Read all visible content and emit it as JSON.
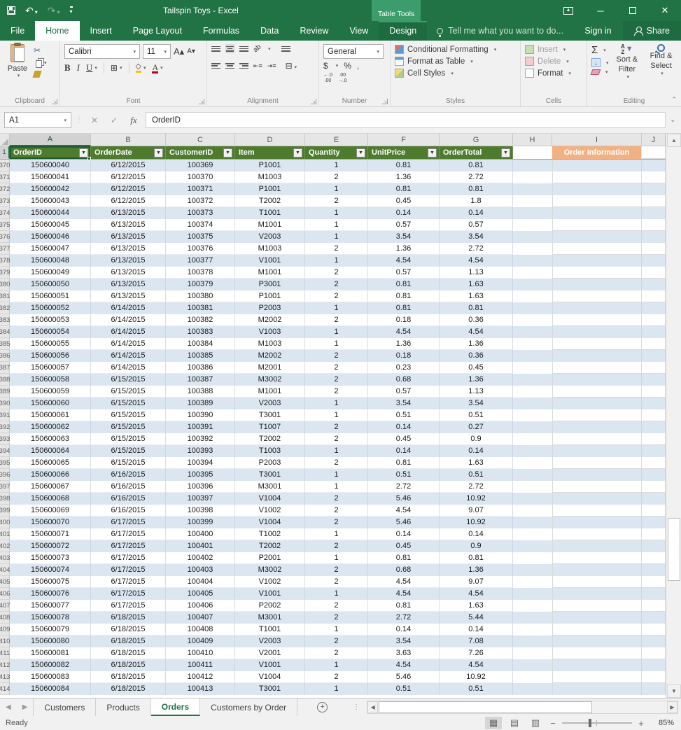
{
  "colors": {
    "brand_green": "#217346",
    "table_header_green": "#4f7b2f",
    "band_blue": "#dce6f1",
    "info_orange": "#f2b183"
  },
  "window": {
    "title": "Tailspin Toys - Excel",
    "context_tab_group": "Table Tools"
  },
  "menu": {
    "tabs": [
      {
        "label": "File",
        "style": "file"
      },
      {
        "label": "Home",
        "style": "active"
      },
      {
        "label": "Insert",
        "style": ""
      },
      {
        "label": "Page Layout",
        "style": ""
      },
      {
        "label": "Formulas",
        "style": ""
      },
      {
        "label": "Data",
        "style": ""
      },
      {
        "label": "Review",
        "style": ""
      },
      {
        "label": "View",
        "style": ""
      },
      {
        "label": "Design",
        "style": "contextual"
      }
    ],
    "tell_me": "Tell me what you want to do...",
    "sign_in": "Sign in",
    "share": "Share"
  },
  "ribbon": {
    "clipboard": {
      "label": "Clipboard",
      "paste": "Paste"
    },
    "font": {
      "label": "Font",
      "name": "Calibri",
      "size": "11",
      "bold": "B",
      "italic": "I",
      "underline": "U"
    },
    "alignment": {
      "label": "Alignment"
    },
    "number": {
      "label": "Number",
      "format": "General",
      "currency": "$",
      "percent": "%",
      "comma": ","
    },
    "styles": {
      "label": "Styles",
      "conditional": "Conditional Formatting",
      "format_table": "Format as Table",
      "cell_styles": "Cell Styles"
    },
    "cells": {
      "label": "Cells",
      "insert": "Insert",
      "delete": "Delete",
      "format": "Format"
    },
    "editing": {
      "label": "Editing",
      "sort_filter": "Sort & Filter",
      "find_select": "Find & Select"
    }
  },
  "formula_bar": {
    "name_box": "A1",
    "fx": "fx",
    "value": "OrderID"
  },
  "sheet": {
    "col_letters": [
      "A",
      "B",
      "C",
      "D",
      "E",
      "F",
      "G",
      "H",
      "I",
      "J"
    ],
    "header_row_num": "1",
    "table_headers": [
      "OrderID",
      "OrderDate",
      "CustomerID",
      "Item",
      "Quantity",
      "UnitPrice",
      "OrderTotal"
    ],
    "info_header": "Order Information",
    "rows": [
      {
        "n": "370",
        "v": [
          "150600040",
          "6/12/2015",
          "100369",
          "P1001",
          "1",
          "0.81",
          "0.81"
        ]
      },
      {
        "n": "371",
        "v": [
          "150600041",
          "6/12/2015",
          "100370",
          "M1003",
          "2",
          "1.36",
          "2.72"
        ]
      },
      {
        "n": "372",
        "v": [
          "150600042",
          "6/12/2015",
          "100371",
          "P1001",
          "1",
          "0.81",
          "0.81"
        ]
      },
      {
        "n": "373",
        "v": [
          "150600043",
          "6/12/2015",
          "100372",
          "T2002",
          "2",
          "0.45",
          "1.8"
        ]
      },
      {
        "n": "374",
        "v": [
          "150600044",
          "6/13/2015",
          "100373",
          "T1001",
          "1",
          "0.14",
          "0.14"
        ]
      },
      {
        "n": "375",
        "v": [
          "150600045",
          "6/13/2015",
          "100374",
          "M1001",
          "1",
          "0.57",
          "0.57"
        ]
      },
      {
        "n": "376",
        "v": [
          "150600046",
          "6/13/2015",
          "100375",
          "V2003",
          "1",
          "3.54",
          "3.54"
        ]
      },
      {
        "n": "377",
        "v": [
          "150600047",
          "6/13/2015",
          "100376",
          "M1003",
          "2",
          "1.36",
          "2.72"
        ]
      },
      {
        "n": "378",
        "v": [
          "150600048",
          "6/13/2015",
          "100377",
          "V1001",
          "1",
          "4.54",
          "4.54"
        ]
      },
      {
        "n": "379",
        "v": [
          "150600049",
          "6/13/2015",
          "100378",
          "M1001",
          "2",
          "0.57",
          "1.13"
        ]
      },
      {
        "n": "380",
        "v": [
          "150600050",
          "6/13/2015",
          "100379",
          "P3001",
          "2",
          "0.81",
          "1.63"
        ]
      },
      {
        "n": "381",
        "v": [
          "150600051",
          "6/13/2015",
          "100380",
          "P1001",
          "2",
          "0.81",
          "1.63"
        ]
      },
      {
        "n": "382",
        "v": [
          "150600052",
          "6/14/2015",
          "100381",
          "P2003",
          "1",
          "0.81",
          "0.81"
        ]
      },
      {
        "n": "383",
        "v": [
          "150600053",
          "6/14/2015",
          "100382",
          "M2002",
          "2",
          "0.18",
          "0.36"
        ]
      },
      {
        "n": "384",
        "v": [
          "150600054",
          "6/14/2015",
          "100383",
          "V1003",
          "1",
          "4.54",
          "4.54"
        ]
      },
      {
        "n": "385",
        "v": [
          "150600055",
          "6/14/2015",
          "100384",
          "M1003",
          "1",
          "1.36",
          "1.36"
        ]
      },
      {
        "n": "386",
        "v": [
          "150600056",
          "6/14/2015",
          "100385",
          "M2002",
          "2",
          "0.18",
          "0.36"
        ]
      },
      {
        "n": "387",
        "v": [
          "150600057",
          "6/14/2015",
          "100386",
          "M2001",
          "2",
          "0.23",
          "0.45"
        ]
      },
      {
        "n": "388",
        "v": [
          "150600058",
          "6/15/2015",
          "100387",
          "M3002",
          "2",
          "0.68",
          "1.36"
        ]
      },
      {
        "n": "389",
        "v": [
          "150600059",
          "6/15/2015",
          "100388",
          "M1001",
          "2",
          "0.57",
          "1.13"
        ]
      },
      {
        "n": "390",
        "v": [
          "150600060",
          "6/15/2015",
          "100389",
          "V2003",
          "1",
          "3.54",
          "3.54"
        ]
      },
      {
        "n": "391",
        "v": [
          "150600061",
          "6/15/2015",
          "100390",
          "T3001",
          "1",
          "0.51",
          "0.51"
        ]
      },
      {
        "n": "392",
        "v": [
          "150600062",
          "6/15/2015",
          "100391",
          "T1007",
          "2",
          "0.14",
          "0.27"
        ]
      },
      {
        "n": "393",
        "v": [
          "150600063",
          "6/15/2015",
          "100392",
          "T2002",
          "2",
          "0.45",
          "0.9"
        ]
      },
      {
        "n": "394",
        "v": [
          "150600064",
          "6/15/2015",
          "100393",
          "T1003",
          "1",
          "0.14",
          "0.14"
        ]
      },
      {
        "n": "395",
        "v": [
          "150600065",
          "6/15/2015",
          "100394",
          "P2003",
          "2",
          "0.81",
          "1.63"
        ]
      },
      {
        "n": "396",
        "v": [
          "150600066",
          "6/16/2015",
          "100395",
          "T3001",
          "1",
          "0.51",
          "0.51"
        ]
      },
      {
        "n": "397",
        "v": [
          "150600067",
          "6/16/2015",
          "100396",
          "M3001",
          "1",
          "2.72",
          "2.72"
        ]
      },
      {
        "n": "398",
        "v": [
          "150600068",
          "6/16/2015",
          "100397",
          "V1004",
          "2",
          "5.46",
          "10.92"
        ]
      },
      {
        "n": "399",
        "v": [
          "150600069",
          "6/16/2015",
          "100398",
          "V1002",
          "2",
          "4.54",
          "9.07"
        ]
      },
      {
        "n": "400",
        "v": [
          "150600070",
          "6/17/2015",
          "100399",
          "V1004",
          "2",
          "5.46",
          "10.92"
        ]
      },
      {
        "n": "401",
        "v": [
          "150600071",
          "6/17/2015",
          "100400",
          "T1002",
          "1",
          "0.14",
          "0.14"
        ]
      },
      {
        "n": "402",
        "v": [
          "150600072",
          "6/17/2015",
          "100401",
          "T2002",
          "2",
          "0.45",
          "0.9"
        ]
      },
      {
        "n": "403",
        "v": [
          "150600073",
          "6/17/2015",
          "100402",
          "P2001",
          "1",
          "0.81",
          "0.81"
        ]
      },
      {
        "n": "404",
        "v": [
          "150600074",
          "6/17/2015",
          "100403",
          "M3002",
          "2",
          "0.68",
          "1.36"
        ]
      },
      {
        "n": "405",
        "v": [
          "150600075",
          "6/17/2015",
          "100404",
          "V1002",
          "2",
          "4.54",
          "9.07"
        ]
      },
      {
        "n": "406",
        "v": [
          "150600076",
          "6/17/2015",
          "100405",
          "V1001",
          "1",
          "4.54",
          "4.54"
        ]
      },
      {
        "n": "407",
        "v": [
          "150600077",
          "6/17/2015",
          "100406",
          "P2002",
          "2",
          "0.81",
          "1.63"
        ]
      },
      {
        "n": "408",
        "v": [
          "150600078",
          "6/18/2015",
          "100407",
          "M3001",
          "2",
          "2.72",
          "5.44"
        ]
      },
      {
        "n": "409",
        "v": [
          "150600079",
          "6/18/2015",
          "100408",
          "T1001",
          "1",
          "0.14",
          "0.14"
        ]
      },
      {
        "n": "410",
        "v": [
          "150600080",
          "6/18/2015",
          "100409",
          "V2003",
          "2",
          "3.54",
          "7.08"
        ]
      },
      {
        "n": "411",
        "v": [
          "150600081",
          "6/18/2015",
          "100410",
          "V2001",
          "2",
          "3.63",
          "7.26"
        ]
      },
      {
        "n": "412",
        "v": [
          "150600082",
          "6/18/2015",
          "100411",
          "V1001",
          "1",
          "4.54",
          "4.54"
        ]
      },
      {
        "n": "413",
        "v": [
          "150600083",
          "6/18/2015",
          "100412",
          "V1004",
          "2",
          "5.46",
          "10.92"
        ]
      },
      {
        "n": "414",
        "v": [
          "150600084",
          "6/18/2015",
          "100413",
          "T3001",
          "1",
          "0.51",
          "0.51"
        ]
      }
    ]
  },
  "sheet_tabs": {
    "tabs": [
      {
        "label": "Customers",
        "active": false
      },
      {
        "label": "Products",
        "active": false
      },
      {
        "label": "Orders",
        "active": true
      },
      {
        "label": "Customers by Order",
        "active": false
      }
    ]
  },
  "status": {
    "mode": "Ready",
    "zoom_level": "85%"
  }
}
